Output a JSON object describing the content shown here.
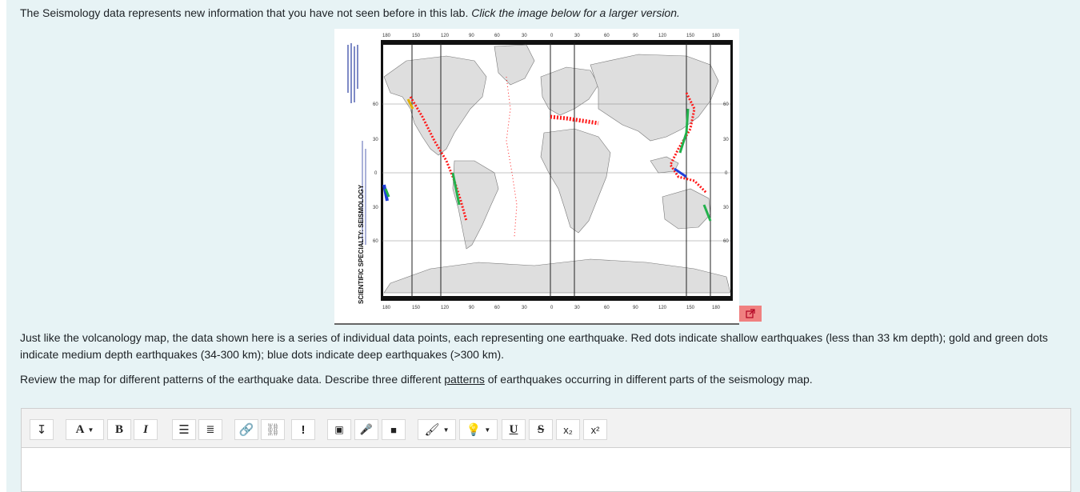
{
  "intro": {
    "text": "The Seismology data represents new information that you have not seen before in this lab.",
    "italic": "Click the image below for a larger version."
  },
  "map": {
    "sidebar_title": "SCIENTIFIC SPECIALTY: SEISMOLOGY",
    "lon_labels": [
      "180",
      "150",
      "120",
      "90",
      "60",
      "30",
      "0",
      "30",
      "60",
      "90",
      "120",
      "150",
      "180"
    ],
    "lat_labels": [
      "60",
      "30",
      "0",
      "30",
      "60"
    ],
    "expand_icon": "external-link-icon"
  },
  "description": {
    "line": "Just like the volcanology map, the data shown here is a series of individual data points, each representing one earthquake. Red dots indicate shallow earthquakes (less than 33 km depth); gold and green dots indicate medium depth earthquakes (34-300 km); blue dots indicate deep earthquakes (>300 km)."
  },
  "question": {
    "before": "Review the map for different patterns of the earthquake data. Describe three different ",
    "link": "patterns",
    "after": " of earthquakes occurring in different parts of the seismology map."
  },
  "toolbar": {
    "font_label": "A",
    "bold_label": "B",
    "italic_label": "I",
    "underline_label": "U",
    "strike_label": "S",
    "subscript_label": "x₂",
    "superscript_label": "x²",
    "alert_label": "!"
  },
  "colors": {
    "shallow": "#ff1a1a",
    "medium_gold": "#e0b000",
    "medium_green": "#22b14c",
    "deep": "#1f3fd9",
    "land": "#dedede"
  }
}
